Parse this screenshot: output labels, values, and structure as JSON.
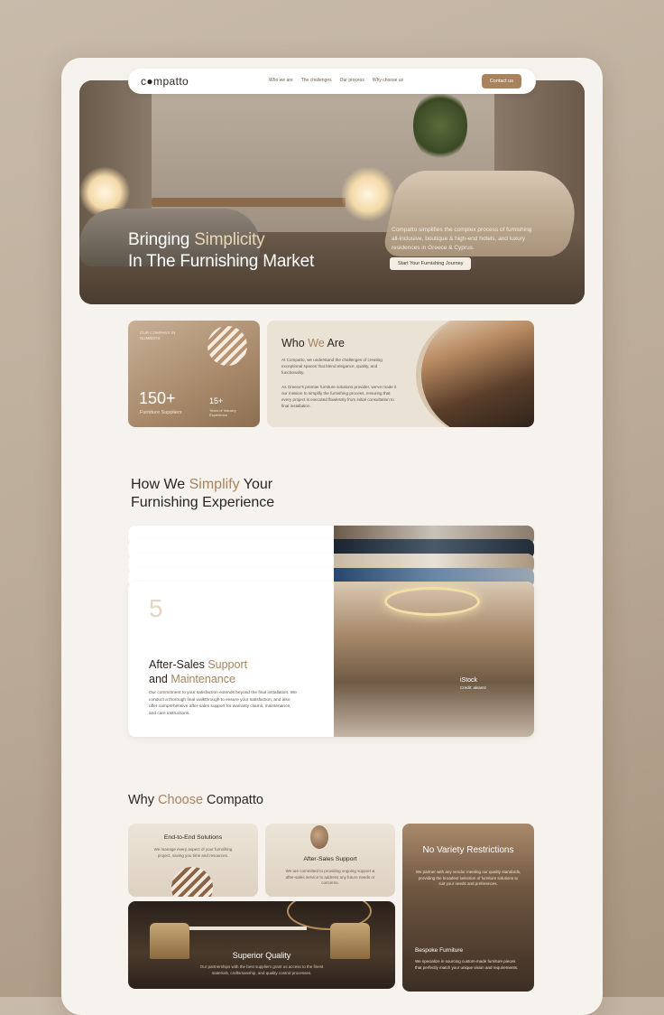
{
  "nav": {
    "logo": "c●mpatto",
    "links": [
      "Who we are",
      "The challenges",
      "Our process",
      "Why choose us"
    ],
    "contact": "Contact us"
  },
  "hero": {
    "title_line1_a": "Bringing ",
    "title_line1_b": "Simplicity",
    "title_line2": "In The Furnishing Market",
    "description": "Compatto simplifies the complex process of furnishing all-inclusive, boutique & high-end hotels, and luxury residences in Greece & Cyprus.",
    "cta": "Start Your Furnishing Journey"
  },
  "numbers": {
    "tag": "OUR COMPANY IN NUMBERS",
    "big_value": "150+",
    "big_label": "Furniture Suppliers",
    "small_value": "15+",
    "small_label": "Years of Industry Experience"
  },
  "who": {
    "title_a": "Who ",
    "title_b": "We",
    "title_c": " Are",
    "p1": "At Compatto, we understand the challenges of creating exceptional spaces that blend elegance, quality, and functionality.",
    "p2": "As Greece's premier furniture solutions provider, we've made it our mission to simplify the furnishing process, ensuring that every project is executed flawlessly from initial consultation to final installation."
  },
  "how": {
    "title_a": "How We ",
    "title_b": "Simplify",
    "title_c": " Your",
    "title_line2": "Furnishing Experience",
    "card": {
      "number": "5",
      "title_a": "After-Sales ",
      "title_b": "Support",
      "title_c": "and ",
      "title_d": "Maintenance",
      "body": "Our commitment to your satisfaction extends beyond the final installation. We conduct a thorough final walkthrough to ensure your satisfaction, and also offer comprehensive after-sales support for warranty claims, maintenance, and care instructions.",
      "image_caption": "iStock",
      "image_credit": "Credit: alvarez"
    }
  },
  "why": {
    "title_a": "Why ",
    "title_b": "Choose",
    "title_c": " Compatto",
    "end_to_end_title": "End-to-End Solutions",
    "end_to_end_body": "We manage every aspect of your furnishing project, saving you time and resources.",
    "after_sales_title": "After-Sales Support",
    "after_sales_body": "We are committed to providing ongoing support & after-sales service to address any future needs or concerns.",
    "variety_title": "No Variety Restrictions",
    "variety_body": "We partner with any vendor meeting our quality standards, providing the broadest selection of furniture solutions to suit your needs and preferences.",
    "bespoke_title": "Bespoke Furniture",
    "bespoke_body": "We specialize in sourcing custom-made furniture pieces that perfectly match your unique vision and requirements.",
    "quality_title": "Superior Quality",
    "quality_body": "Our partnerships with the best suppliers grant us access to the finest materials, craftsmanship, and quality control processes."
  },
  "colors": {
    "accent": "#a8825d",
    "page_background": "#f6f3ee"
  }
}
